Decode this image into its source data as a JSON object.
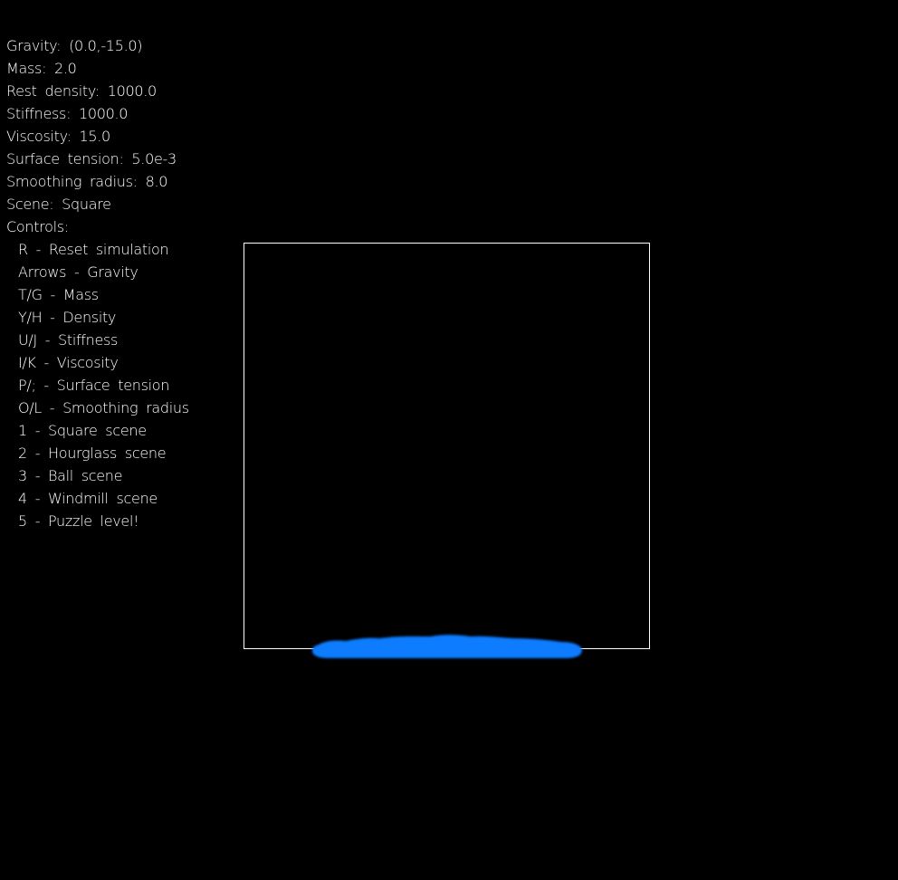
{
  "hud": {
    "params": [
      {
        "label": "Gravity:",
        "value": "(0.0,-15.0)"
      },
      {
        "label": "Mass:",
        "value": "2.0"
      },
      {
        "label": "Rest density:",
        "value": "1000.0"
      },
      {
        "label": "Stiffness:",
        "value": "1000.0"
      },
      {
        "label": "Viscosity:",
        "value": "15.0"
      },
      {
        "label": "Surface tension:",
        "value": "5.0e-3"
      },
      {
        "label": "Smoothing radius:",
        "value": "8.0"
      },
      {
        "label": "Scene:",
        "value": "Square"
      }
    ],
    "controls_heading": "Controls:",
    "controls": [
      {
        "key": "R",
        "action": "Reset simulation"
      },
      {
        "key": "Arrows",
        "action": "Gravity"
      },
      {
        "key": "T/G",
        "action": "Mass"
      },
      {
        "key": "Y/H",
        "action": "Density"
      },
      {
        "key": "U/J",
        "action": "Stiffness"
      },
      {
        "key": "I/K",
        "action": "Viscosity"
      },
      {
        "key": "P/;",
        "action": "Surface tension"
      },
      {
        "key": "O/L",
        "action": "Smoothing radius"
      },
      {
        "key": "1",
        "action": "Square scene"
      },
      {
        "key": "2",
        "action": "Hourglass scene"
      },
      {
        "key": "3",
        "action": "Ball scene"
      },
      {
        "key": "4",
        "action": "Windmill scene"
      },
      {
        "key": "5",
        "action": "Puzzle level!"
      }
    ],
    "separator": "-"
  },
  "colors": {
    "background": "#000000",
    "text": "#ffffff",
    "container_border": "#ffffff",
    "fluid": "#0a7cff"
  }
}
